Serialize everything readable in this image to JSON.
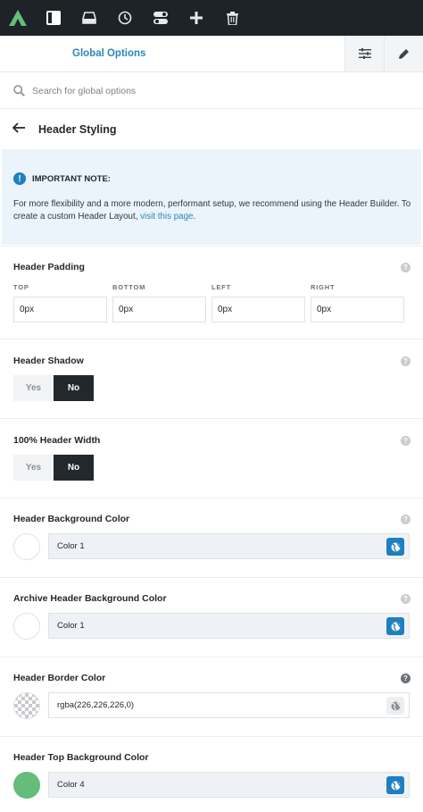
{
  "toolbar": {
    "logo_icon": "avada-logo-icon",
    "buttons": [
      {
        "name": "sidebar-panel-icon",
        "active": true
      },
      {
        "name": "layout-icon"
      },
      {
        "name": "history-icon"
      },
      {
        "name": "toggle-icon"
      },
      {
        "name": "add-icon"
      },
      {
        "name": "trash-icon"
      }
    ],
    "accent": "#65bc7b"
  },
  "panel": {
    "title": "Global Options",
    "buttons": [
      "sliders-icon",
      "pen-icon"
    ]
  },
  "search": {
    "placeholder": "Search for global options"
  },
  "back": {
    "title": "Header Styling"
  },
  "note": {
    "title": "IMPORTANT NOTE:",
    "body_before": "For more flexibility and a more modern, performant setup, we recommend using the Header Builder. To create a custom Header Layout, ",
    "link": "visit this page",
    "body_after": "."
  },
  "padding": {
    "label": "Header Padding",
    "fields": [
      {
        "label": "TOP",
        "value": "0px"
      },
      {
        "label": "BOTTOM",
        "value": "0px"
      },
      {
        "label": "LEFT",
        "value": "0px"
      },
      {
        "label": "RIGHT",
        "value": "0px"
      }
    ]
  },
  "shadow": {
    "label": "Header Shadow",
    "yes": "Yes",
    "no": "No",
    "selected": "No"
  },
  "width": {
    "label": "100% Header Width",
    "yes": "Yes",
    "no": "No",
    "selected": "No"
  },
  "colors": [
    {
      "label": "Header Background Color",
      "value": "Color 1",
      "swatch": "#ffffff",
      "global": true
    },
    {
      "label": "Archive Header Background Color",
      "value": "Color 1",
      "swatch": "#ffffff",
      "global": true
    },
    {
      "label": "Header Border Color",
      "value": "rgba(226,226,226,0)",
      "swatch": "transparent",
      "global": false
    },
    {
      "label": "Header Top Background Color",
      "value": "Color 4",
      "swatch": "#65bc7b",
      "global": true
    }
  ]
}
